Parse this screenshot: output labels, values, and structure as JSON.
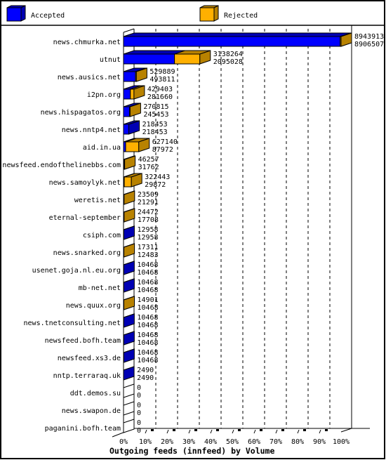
{
  "chart_data": {
    "type": "bar",
    "orientation": "horizontal",
    "stacked": true,
    "style": "3d",
    "title": "Outgoing feeds (innfeed) by Volume",
    "xlabel": "",
    "ylabel": "",
    "x_unit": "% of largest feed",
    "xlim": [
      0,
      100
    ],
    "x_ticks": [
      "0%",
      "10%",
      "20%",
      "30%",
      "40%",
      "50%",
      "60%",
      "70%",
      "80%",
      "90%",
      "100%"
    ],
    "grid": true,
    "legend": {
      "position": "top",
      "entries": [
        {
          "label": "Accepted",
          "color": "#0000ff",
          "shade": "#0000b4"
        },
        {
          "label": "Rejected",
          "color": "#ffb000",
          "shade": "#b88200"
        }
      ]
    },
    "categories": [
      "news.chmurka.net",
      "utnut",
      "news.ausics.net",
      "i2pn.org",
      "news.hispagatos.org",
      "news.nntp4.net",
      "aid.in.ua",
      "newsfeed.endofthelinebbs.com",
      "news.samoylyk.net",
      "weretis.net",
      "eternal-september",
      "csiph.com",
      "news.snarked.org",
      "usenet.goja.nl.eu.org",
      "mb-net.net",
      "news.quux.org",
      "news.tnetconsulting.net",
      "newsfeed.bofh.team",
      "newsfeed.xs3.de",
      "nntp.terraraq.uk",
      "ddt.demos.su",
      "news.swapon.de",
      "paganini.bofh.team"
    ],
    "totals": [
      8943913,
      3138264,
      529889,
      429403,
      270815,
      218453,
      627140,
      46257,
      322443,
      23509,
      24472,
      12958,
      17311,
      10468,
      10468,
      14901,
      10468,
      10468,
      10468,
      2490,
      0,
      0,
      0
    ],
    "series": [
      {
        "name": "Accepted",
        "values": [
          8906507,
          2095028,
          493811,
          281660,
          245453,
          218453,
          87972,
          31762,
          29872,
          21291,
          17708,
          12958,
          12483,
          10468,
          10468,
          10468,
          10468,
          10468,
          10468,
          2490,
          0,
          0,
          0
        ]
      },
      {
        "name": "Rejected",
        "values": [
          37406,
          1043236,
          36078,
          147743,
          25362,
          0,
          539168,
          14495,
          292571,
          2218,
          6764,
          0,
          4828,
          0,
          0,
          4433,
          0,
          0,
          0,
          0,
          0,
          0,
          0
        ]
      }
    ]
  }
}
